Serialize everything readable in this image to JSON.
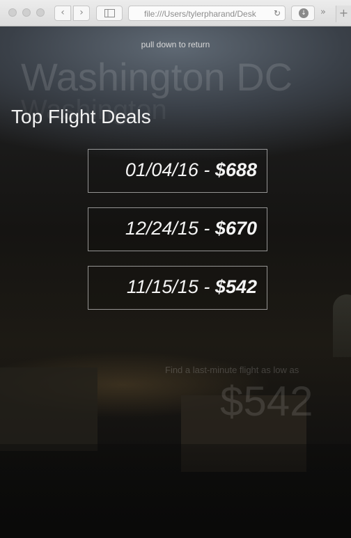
{
  "browser": {
    "url": "file:///Users/tylerpharand/Desk",
    "back_icon": "‹",
    "forward_icon": "›",
    "reload_icon": "↻",
    "download_icon": "↓",
    "overflow_icon": "»",
    "new_tab_icon": "+"
  },
  "page": {
    "pull_hint": "pull down to return",
    "background_city": "Washington DC",
    "background_city_echo": "Washington",
    "section_title": "Top Flight Deals",
    "deals": [
      {
        "date": "01/04/16",
        "separator": " - ",
        "price": "$688"
      },
      {
        "date": "12/24/15",
        "separator": " - ",
        "price": "$670"
      },
      {
        "date": "11/15/15",
        "separator": " - ",
        "price": "$542"
      }
    ],
    "background_tagline": "Find a last-minute flight as low as",
    "background_price": "$542"
  },
  "colors": {
    "text_primary": "#f2f2f2",
    "deal_border": "#8c8c8c",
    "chrome_bg": "#e4e4e4"
  }
}
